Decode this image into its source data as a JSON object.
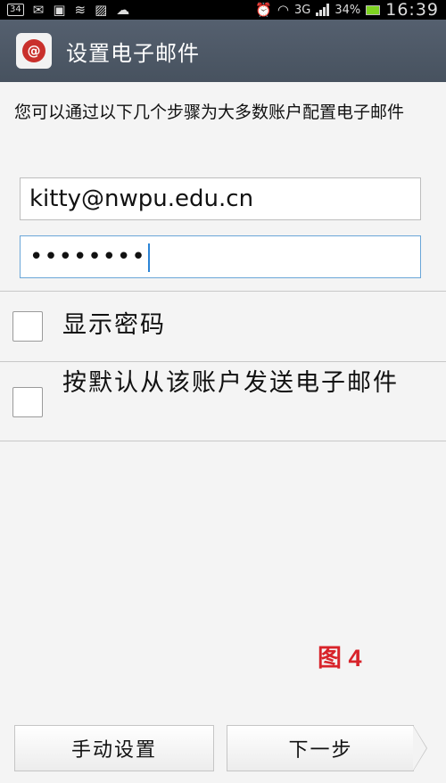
{
  "status_bar": {
    "notification_count": "34",
    "network": "3G",
    "battery": "34%",
    "time": "16:39",
    "icons": [
      "mail-icon",
      "app-store-icon",
      "wifi-icon",
      "image-icon",
      "wechat-icon",
      "alarm-icon",
      "signal-icon",
      "battery-icon"
    ]
  },
  "action_bar": {
    "title": "设置电子邮件",
    "icon_symbol": "@"
  },
  "intro_text": "您可以通过以下几个步骤为大多数账户配置电子邮件",
  "form": {
    "email_value": "kitty@nwpu.edu.cn",
    "password_mask": "••••••••"
  },
  "options": {
    "show_password": "显示密码",
    "default_account": "按默认从该账户发送电子邮件"
  },
  "annotation": "图 4",
  "buttons": {
    "manual_setup": "手动设置",
    "next": "下一步"
  },
  "colors": {
    "action_bar": "#4a5568",
    "focus_border": "#6aa6d8",
    "annotation": "#d8232a"
  }
}
